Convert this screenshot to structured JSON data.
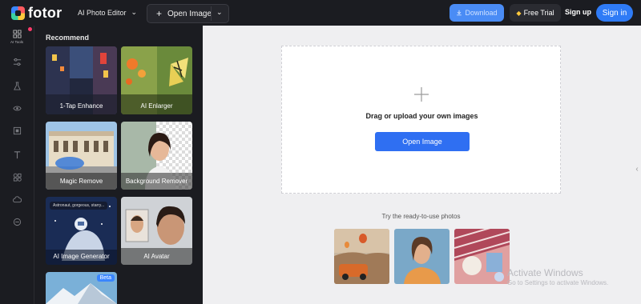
{
  "app": {
    "logo_text": "fotor"
  },
  "topbar": {
    "editor_menu": "AI Photo Editor",
    "open_image": "Open Image",
    "download": "Download",
    "free_trial": "Free Trial",
    "sign_up": "Sign up",
    "sign_in": "Sign in"
  },
  "rail": {
    "ai_tools_label": "AI Tools"
  },
  "panel": {
    "title": "Recommend",
    "tiles": [
      {
        "label": "1-Tap Enhance"
      },
      {
        "label": "AI Enlarger"
      },
      {
        "label": "Magic Remove"
      },
      {
        "label": "Background Remover"
      },
      {
        "label": "AI Image Generator"
      },
      {
        "label": "AI Avatar"
      },
      {
        "label": "",
        "badge": "Beta"
      }
    ],
    "generator_prompt": "Astronaut, gorgeous, starry..."
  },
  "main": {
    "upload_text": "Drag or upload your own images",
    "open_button": "Open Image",
    "ready_text": "Try the ready-to-use photos"
  },
  "watermark": {
    "line1": "Activate Windows",
    "line2": "Go to Settings to activate Windows."
  },
  "colors": {
    "accent": "#2f6ff2",
    "dark": "#1b1c21",
    "badge": "#ff3b6b"
  }
}
